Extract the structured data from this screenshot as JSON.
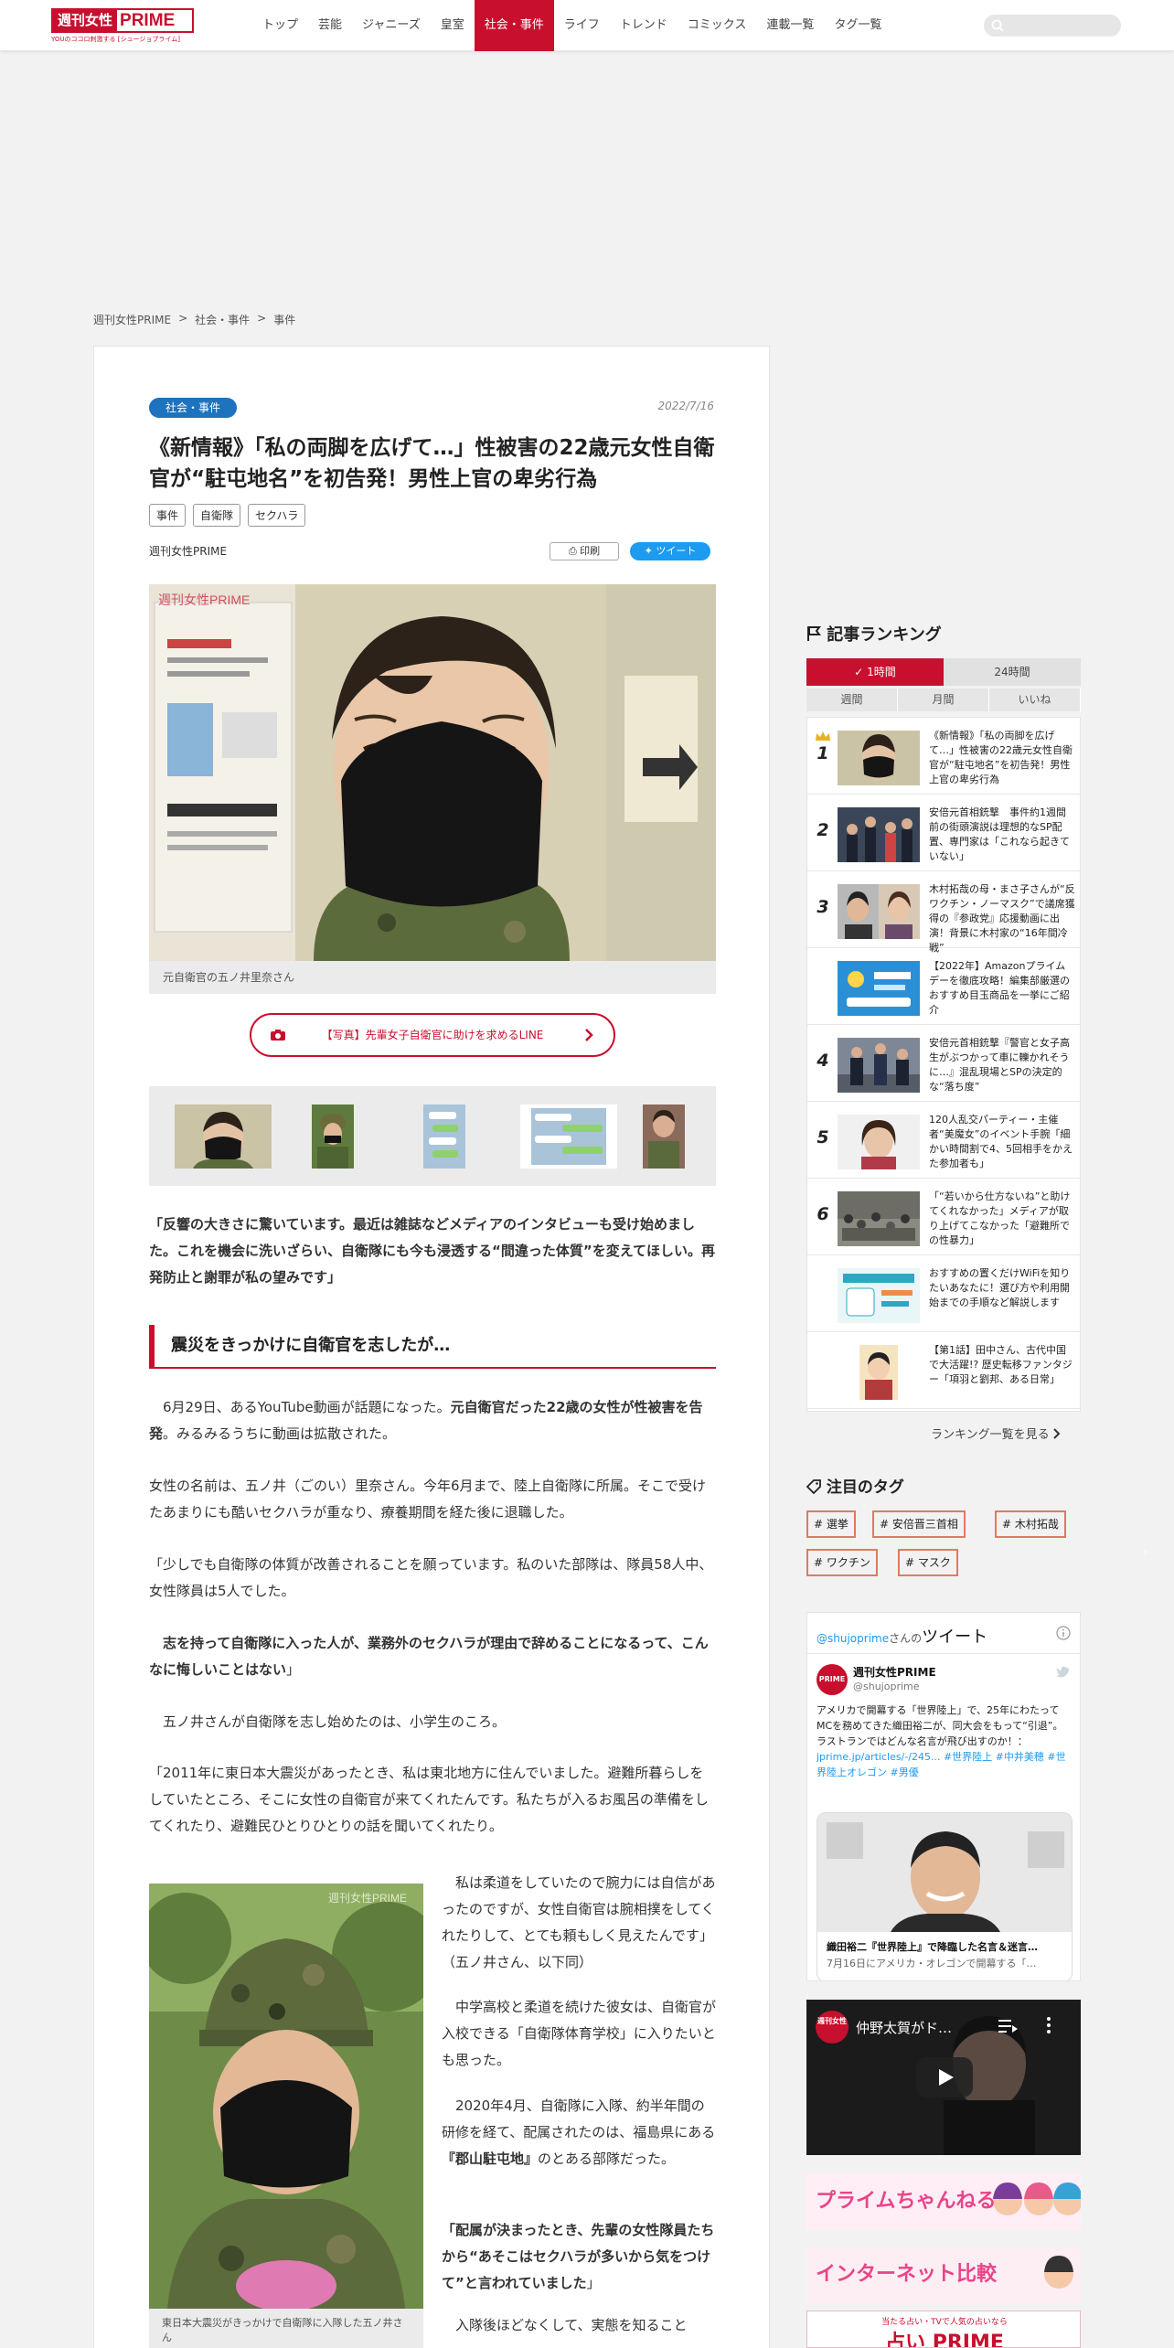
{
  "header": {
    "logo_jp": "週刊女性",
    "logo_en": "PRIME",
    "logo_tagline": "YOUのココロ刺激する [シュージョプライム]",
    "nav": [
      "トップ",
      "芸能",
      "ジャニーズ",
      "皇室",
      "社会・事件",
      "ライフ",
      "トレンド",
      "コミックス",
      "連載一覧",
      "タグ一覧"
    ],
    "active_nav": "社会・事件",
    "search_placeholder": "",
    "accent_color": "#c8102e"
  },
  "breadcrumb": [
    "週刊女性PRIME",
    "社会・事件",
    "事件"
  ],
  "breadcrumb_sep": ">",
  "article": {
    "category": "社会・事件",
    "date": "2022/7/16",
    "title": "《新情報》「私の両脚を広げて…」性被害の22歳元女性自衛官が“駐屯地名”を初告発！男性上官の卑劣行為",
    "tags": [
      "事件",
      "自衛隊",
      "セクハラ"
    ],
    "source": "週刊女性PRIME",
    "print_label": "印刷",
    "tweet_label": "ツイート",
    "photo_watermark": "週刊女性PRIME",
    "photo_caption": "元自衛官の五ノ井里奈さん",
    "photo_button": "【写真】先輩女子自衛官に助けを求めるLINE",
    "lead_quote": "「反響の大きさに驚いています。最近は雑誌などメディアのインタビューも受け始めました。これを機会に洗いざらい、自衛隊にも今も浸透する“間違った体質”を変えてほしい。再発防止と謝罪が私の望みです」",
    "heading": "震災をきっかけに自衛官を志したが…",
    "p1_pre": "6月29日、あるYouTube動画が話題になった。",
    "p1_bold": "元自衛官だった22歳の女性が性被害を告発",
    "p1_post": "。みるみるうちに動画は拡散された。",
    "p2": "女性の名前は、五ノ井（ごのい）里奈さん。今年6月まで、陸上自衛隊に所属。そこで受けたあまりにも酷いセクハラが重なり、療養期間を経た後に退職した。",
    "p3": "「少しでも自衛隊の体質が改善されることを願っています。私のいた部隊は、隊員58人中、女性隊員は5人でした。",
    "p4_bold": "志を持って自衛隊に入った人が、業務外のセクハラが理由で辞めることになるって、こんなに悔しいことはない",
    "p4_end": "」",
    "p5": "五ノ井さんが自衛隊を志し始めたのは、小学生のころ。",
    "p6": "「2011年に東日本大震災があったとき、私は東北地方に住んでいました。避難所暮らしをしていたところ、そこに女性の自衛官が来てくれたんです。私たちが入るお風呂の準備をしてくれたり、避難民ひとりひとりの話を聞いてくれたり。",
    "sub_caption": "東日本大震災がきっかけで自衛隊に入隊した五ノ井さん",
    "c1": "私は柔道をしていたので腕力には自信があったのですが、女性自衛官は腕相撲をしてくれたりして、とても頼もしく見えたんです」（五ノ井さん、以下同）",
    "c2": "中学高校と柔道を続けた彼女は、自衛官が入校できる「自衛隊体育学校」に入りたいとも思った。",
    "c3_pre": "2020年4月、自衛隊に入隊、約半年間の研修を経て、配属されたのは、福島県にある",
    "c3_bold": "『郡山駐屯地』",
    "c3_post": "のとある部隊だった。",
    "c4_bold": "「配属が決まったとき、先輩の女性隊員たちから“あそこはセクハラが多いから気をつけて”と言われていました",
    "c4_end": "」",
    "c5": "入隊後ほどなくして、実態を知ること"
  },
  "sidebar": {
    "ranking_title": "記事ランキング",
    "tabs": [
      "1時間",
      "24時間"
    ],
    "subtabs": [
      "週間",
      "月間",
      "いいね"
    ],
    "items": [
      {
        "rank": "1",
        "text": "《新情報》「私の両脚を広げて…」性被害の22歳元女性自衛官が“駐屯地名”を初告発！男性上官の卑劣行為"
      },
      {
        "rank": "2",
        "text": "安倍元首相銃撃　事件約1週間前の街頭演説は理想的なSP配置、専門家は「これなら起きていない」"
      },
      {
        "rank": "3",
        "text": "木村拓哉の母・まさ子さんが“反ワクチン・ノーマスク”で議席獲得の『参政党』応援動画に出演！背景に木村家の“16年間冷戦”"
      },
      {
        "rank": "",
        "text": "【2022年】Amazonプライムデーを徹底攻略！編集部厳選のおすすめ目玉商品を一挙にご紹介"
      },
      {
        "rank": "4",
        "text": "安倍元首相銃撃『警官と女子高生がぶつかって車に轢かれそうに…』混乱現場とSPの決定的な“落ち度”"
      },
      {
        "rank": "5",
        "text": "120人乱交パーティー・主催者“美魔女”のイベント手腕「細かい時間割で4、5回相手をかえた参加者も」"
      },
      {
        "rank": "6",
        "text": "「“若いから仕方ないね”と助けてくれなかった」メディアが取り上げてこなかった「避難所での性暴力」"
      },
      {
        "rank": "",
        "text": "おすすめの置くだけWiFiを知りたいあなたに！選び方や利用開始までの手順など解説します"
      },
      {
        "rank": "",
        "text": "【第1話】田中さん、古代中国で大活躍!? 歴史転移ファンタジー「項羽と劉邦、ある日常」"
      }
    ],
    "ranking_more": "ランキング一覧を見る",
    "tags_title": "注目のタグ",
    "hot_tags": [
      "# 選挙",
      "# 安倍晋三首相",
      "# 木村拓哉",
      "# ワクチン",
      "# マスク"
    ],
    "twitter": {
      "handle_link": "@shujoprime",
      "handle_suffix": "さんの",
      "heading": "ツイート",
      "account_name": "週刊女性PRIME",
      "account_handle": "@shujoprime",
      "tweet_text": "アメリカで開幕する「世界陸上」で、25年にわたってMCを務めてきた織田裕二が、同大会をもって“引退”。ラストランではどんな名言が飛び出すのか！：",
      "tweet_link": "jprime.jp/articles/-/245... #世界陸上 #中井美穂 #世界陸上オレゴン #男優",
      "card_title": "織田裕二『世界陸上』で降臨した名言＆迷言…",
      "card_sub": "7月16日にアメリカ・オレゴンで開幕する「…"
    },
    "video_badge": "週刊女性",
    "video_title": "仲野太賀がド…",
    "banner1": "プライムちゃんねる",
    "banner2": "インターネット比較",
    "banner3_small": "当たる占い・TVで人気の占いなら",
    "banner3": "占い PRIME"
  }
}
